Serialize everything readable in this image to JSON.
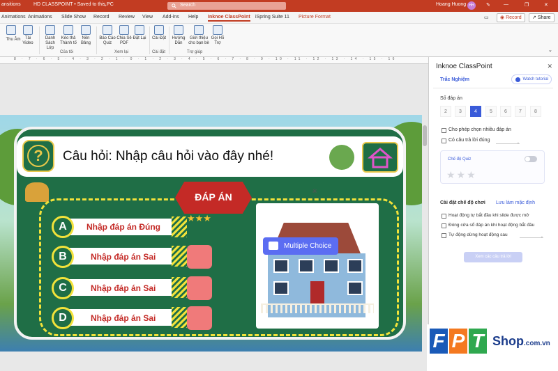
{
  "titlebar": {
    "left_text": "ansitions",
    "doc_title": "HD CLASSPOINT • Saved to this PC",
    "search_placeholder": "Search",
    "user_name": "Hoang Huong",
    "user_initials": "HH",
    "accent": "#c23c22"
  },
  "tabs": {
    "items": [
      "Animations",
      "Slide Show",
      "Record",
      "Review",
      "View",
      "Add-ins",
      "Help",
      "Inknoe ClassPoint",
      "iSpring Suite 11",
      "Picture Format"
    ],
    "active": "Inknoe ClassPoint",
    "record_label": "Record",
    "share_label": "Share"
  },
  "ribbon": {
    "buttons": [
      {
        "label": "Thu Âm",
        "icon": "microphone-icon"
      },
      {
        "label": "Tải Video",
        "icon": "video-icon"
      },
      {
        "label": "Danh Sách Lớp",
        "icon": "list-icon"
      },
      {
        "label": "Kéo thả Thành tố",
        "icon": "drag-icon"
      },
      {
        "label": "Nền Bảng",
        "icon": "board-icon"
      },
      {
        "label": "Báo Cáo Quiz",
        "icon": "report-icon"
      },
      {
        "label": "Chia Sẻ PDF",
        "icon": "pdf-icon"
      },
      {
        "label": "Đặt Lại",
        "icon": "reset-icon"
      },
      {
        "label": "Cài Đặt",
        "icon": "settings-icon"
      },
      {
        "label": "Hướng Dẫn",
        "icon": "guide-icon"
      },
      {
        "label": "Giới thiệu cho bạn bè",
        "icon": "share-friends-icon"
      },
      {
        "label": "Gọi Hỗ Trợ",
        "icon": "help-icon"
      }
    ],
    "groups": [
      "Của tôi",
      "Xem lại",
      "Cài đặt",
      "Trợ giúp"
    ]
  },
  "ruler": "8 · 7 · 6 · 5 · 4 · 3 · 2 · 1 · 0 · 1 · 2 · 3 · 4 · 5 · 6 · 7 · 8 · 9 · 10 · 11 · 12 · 13 · 14 · 15 · 16",
  "slide": {
    "question": "Câu hỏi: Nhập câu hỏi vào đây nhé!",
    "answer_badge": "ĐÁP ÁN",
    "options": [
      {
        "letter": "A",
        "text": "Nhập đáp án Đúng"
      },
      {
        "letter": "B",
        "text": "Nhập đáp án Sai"
      },
      {
        "letter": "C",
        "text": "Nhập đáp án Sai"
      },
      {
        "letter": "D",
        "text": "Nhập đáp án Sai"
      }
    ],
    "stars": "★★★",
    "multiple_choice_badge": "Multiple Choice"
  },
  "watermark": {
    "letters": [
      "F",
      "P",
      "T"
    ],
    "shop": "Shop",
    "domain": ".com.vn"
  },
  "panel": {
    "title": "Inknoe ClassPoint",
    "close": "✕",
    "subtitle": "Trắc Nghiệm",
    "watch_tutorial": "Watch tutorial",
    "num_answers_label": "Số đáp án",
    "numbers": [
      "2",
      "3",
      "4",
      "5",
      "6",
      "7",
      "8"
    ],
    "selected_number": "4",
    "allow_multiple": "Cho phép chọn nhiều đáp án",
    "has_correct": "Có câu trả lời đúng",
    "quiz_mode": "Chế độ Quiz",
    "quiz_stars": "★★★",
    "play_settings": "Cài đặt chế độ chơi",
    "default_link": "Lưu làm mặc định",
    "settings": [
      "Hoạt động tự bắt đầu khi slide được mở",
      "Đóng cửa sổ đáp án khi hoạt động bắt đầu",
      "Tự động dừng hoạt động sau"
    ],
    "collect_button": "Xem các câu trả lời"
  }
}
